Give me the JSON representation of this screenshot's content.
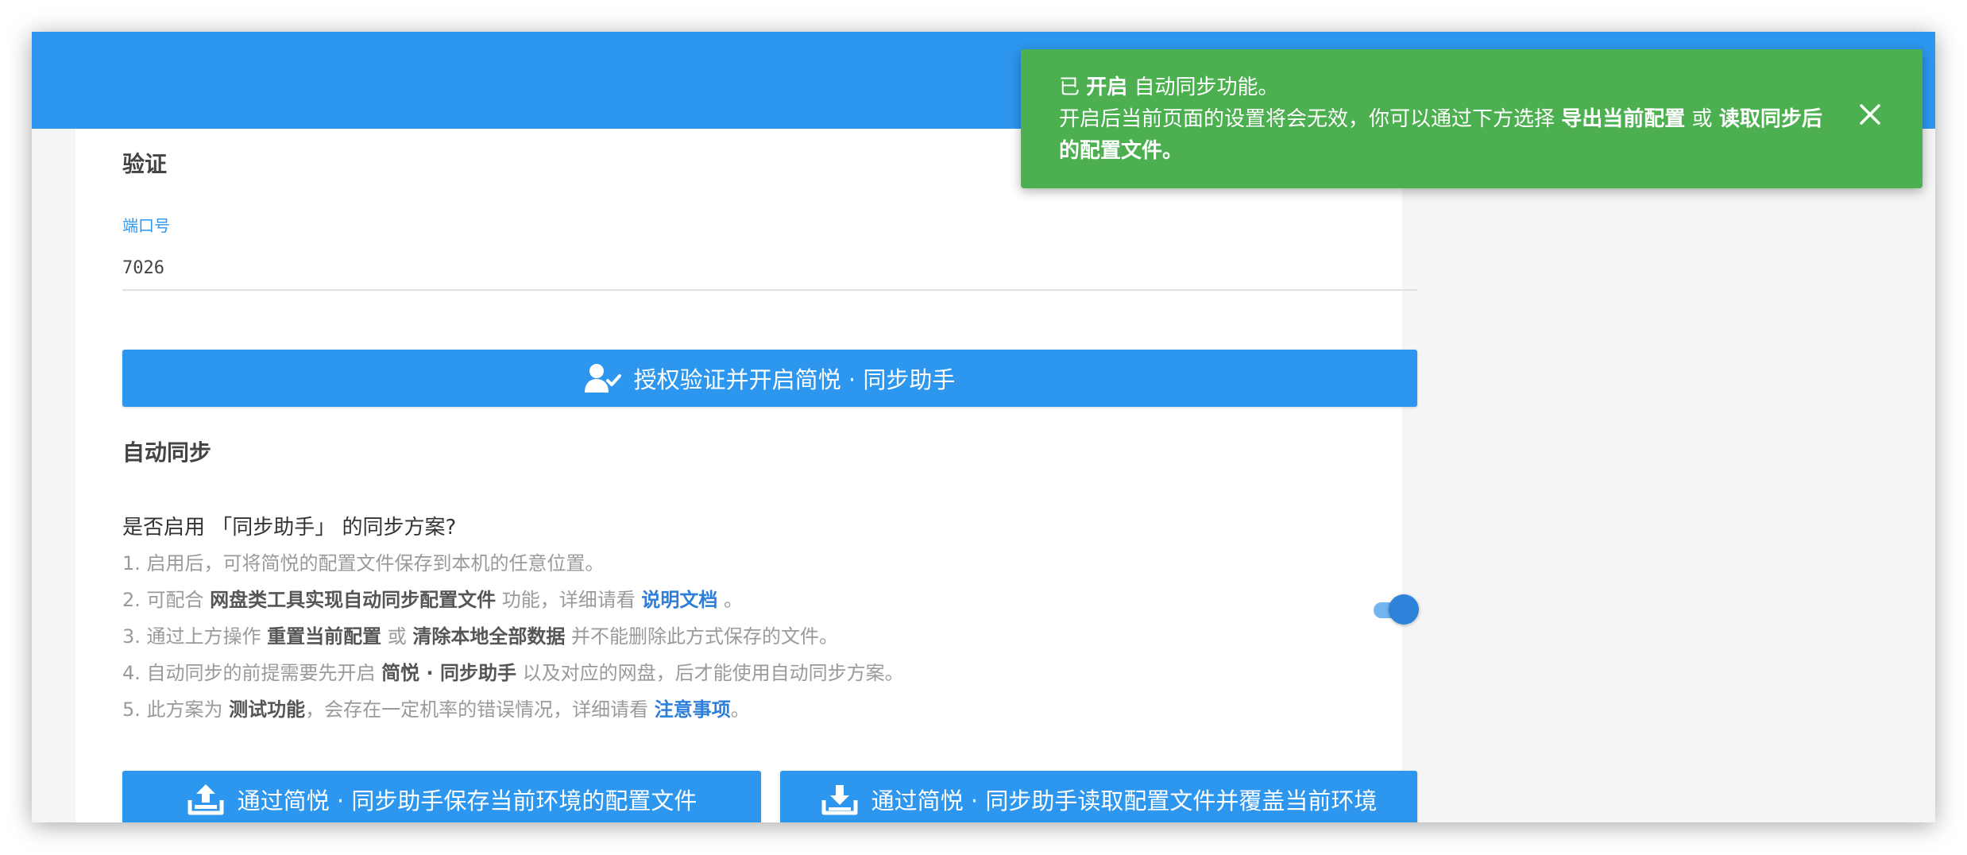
{
  "section": {
    "verify_title": "验证",
    "auto_sync_title": "自动同步"
  },
  "port": {
    "label": "端口号",
    "value": "7026"
  },
  "buttons": {
    "auth": "授权验证并开启简悦 · 同步助手",
    "save": "通过简悦 · 同步助手保存当前环境的配置文件",
    "load": "通过简悦 · 同步助手读取配置文件并覆盖当前环境"
  },
  "question": "是否启用 「同步助手」 的同步方案?",
  "toggle": {
    "enabled": true
  },
  "lines": [
    {
      "a": "1. 启用后，可将简悦的配置文件保存到本机的任意位置。"
    },
    {
      "a": "2. 可配合 ",
      "b": "网盘类工具实现自动同步配置文件",
      "c": " 功能，详细请看 ",
      "link": "说明文档",
      "d": " 。"
    },
    {
      "a": "3. 通过上方操作 ",
      "b": "重置当前配置",
      "c": " 或 ",
      "b2": "清除本地全部数据",
      "d": " 并不能删除此方式保存的文件。"
    },
    {
      "a": "4. 自动同步的前提需要先开启 ",
      "b": "简悦 · 同步助手",
      "c": " 以及对应的网盘，后才能使用自动同步方案。"
    },
    {
      "a": "5. 此方案为 ",
      "b": "测试功能",
      "c": "，会存在一定机率的错误情况，详细请看 ",
      "link": "注意事项",
      "d": "。"
    }
  ],
  "toast": {
    "l1_a": "已 ",
    "l1_b": "开启",
    "l1_c": " 自动同步功能。",
    "l2_a": "开启后当前页面的设置将会无效，你可以通过下方选择 ",
    "l2_b": "导出当前配置",
    "l2_c": " 或 ",
    "l2_d": "读取同步后的配置文件。"
  },
  "colors": {
    "primary": "#2d96ee",
    "success": "#4caf50",
    "link": "#2d7ed9"
  }
}
